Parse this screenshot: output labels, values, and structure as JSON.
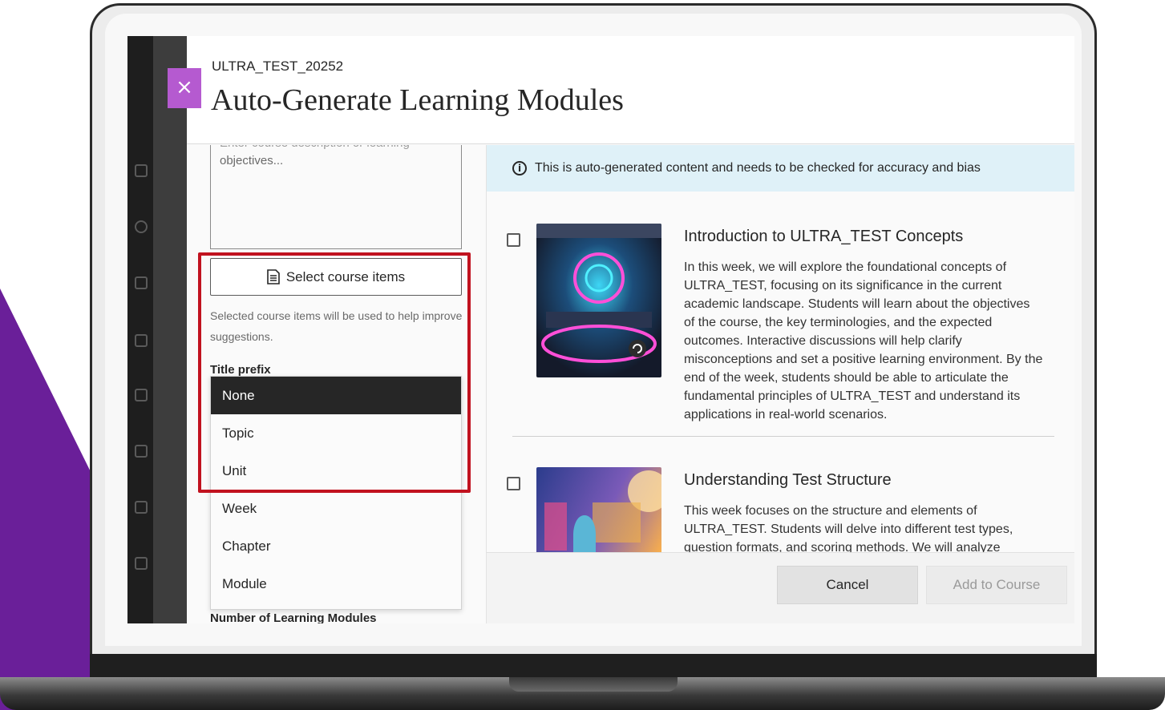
{
  "dialog": {
    "course_id": "ULTRA_TEST_20252",
    "title": "Auto-Generate Learning Modules",
    "close_icon": "close-icon"
  },
  "form": {
    "description_placeholder_cut": "Enter course description or learning",
    "description_placeholder": "objectives...",
    "select_items_label": "Select course items",
    "helper_text": "Selected course items will be used to help improve suggestions.",
    "title_prefix_label": "Title prefix",
    "title_prefix_options": [
      "None",
      "Topic",
      "Unit",
      "Week",
      "Chapter",
      "Module"
    ],
    "title_prefix_selected": "None",
    "modules_count_label": "Number of Learning Modules"
  },
  "notice": {
    "text": "This is auto-generated content and needs to be checked for accuracy and bias",
    "icon": "info-icon"
  },
  "modules": [
    {
      "title": "Introduction to ULTRA_TEST Concepts",
      "description": "In this week, we will explore the foundational concepts of ULTRA_TEST, focusing on its significance in the current academic landscape. Students will learn about the objectives of the course, the key terminologies, and the expected outcomes. Interactive discussions will help clarify misconceptions and set a positive learning environment. By the end of the week, students should be able to articulate the fundamental principles of ULTRA_TEST and understand its applications in real-world scenarios."
    },
    {
      "title": "Understanding Test Structure",
      "description": "This week focuses on the structure and elements of ULTRA_TEST. Students will delve into different test types, question formats, and scoring methods. We will analyze sample tests to identify critical"
    }
  ],
  "footer": {
    "cancel_label": "Cancel",
    "add_label": "Add to Course"
  },
  "colors": {
    "accent": "#b55ad0",
    "highlight": "#c1121f",
    "notice_bg": "#dff1f8",
    "selected_bg": "#262626",
    "backdrop_purple": "#6a1f99"
  }
}
